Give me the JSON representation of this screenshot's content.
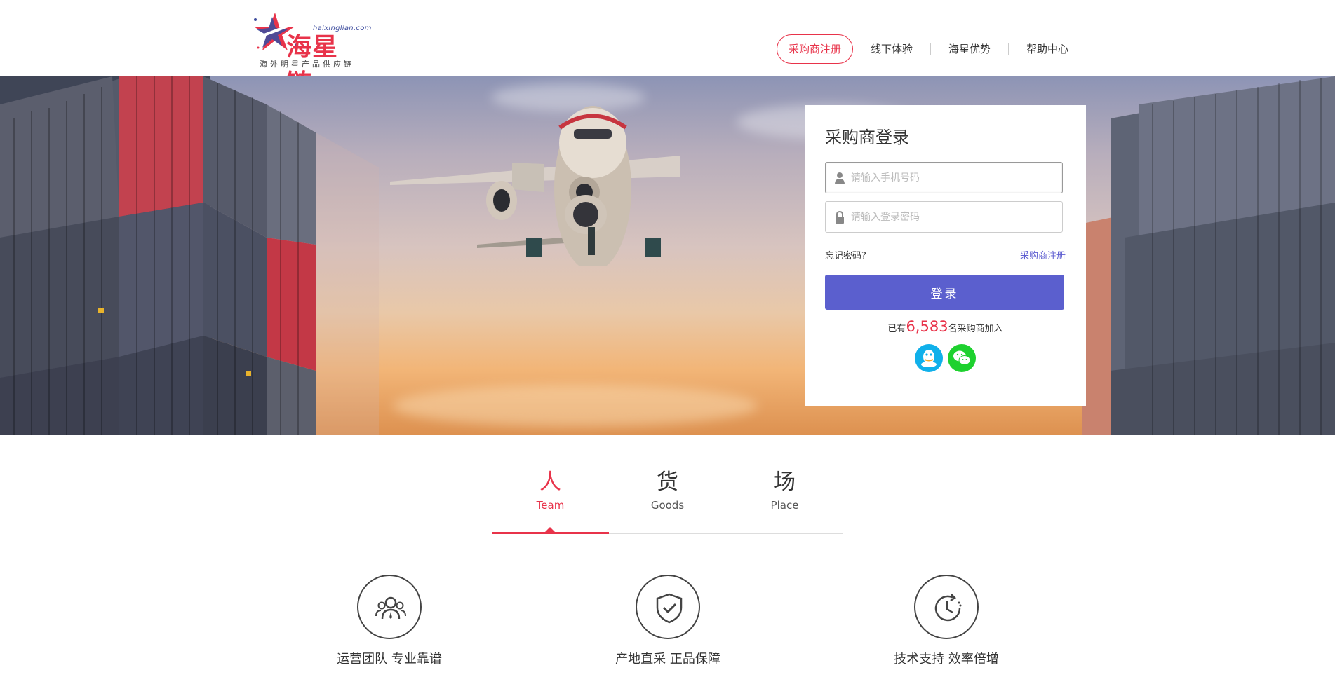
{
  "brand": {
    "name": "海星链",
    "url": "haixinglian.com",
    "slogan": "海外明星产品供应链",
    "colors": {
      "primary": "#e8334a",
      "accent": "#5b5fce",
      "logo_blue": "#3e4d9e"
    }
  },
  "nav": {
    "items": [
      {
        "label": "采购商注册",
        "active": true
      },
      {
        "label": "线下体验"
      },
      {
        "label": "海星优势"
      },
      {
        "label": "帮助中心"
      }
    ]
  },
  "login": {
    "title": "采购商登录",
    "phone_placeholder": "请输入手机号码",
    "password_placeholder": "请输入登录密码",
    "forgot_label": "忘记密码?",
    "register_label": "采购商注册",
    "submit_label": "登录",
    "count_prefix": "已有",
    "count_value": "6,583",
    "count_suffix": "名采购商加入",
    "social_icons": [
      "qq-icon",
      "wechat-icon"
    ]
  },
  "tabs": [
    {
      "cn": "人",
      "en": "Team",
      "active": true
    },
    {
      "cn": "货",
      "en": "Goods"
    },
    {
      "cn": "场",
      "en": "Place"
    }
  ],
  "features": [
    {
      "icon": "team-icon",
      "label": "运营团队 专业靠谱"
    },
    {
      "icon": "shield-check-icon",
      "label": "产地直采 正品保障"
    },
    {
      "icon": "clock-icon",
      "label": "技术支持 效率倍增"
    }
  ]
}
